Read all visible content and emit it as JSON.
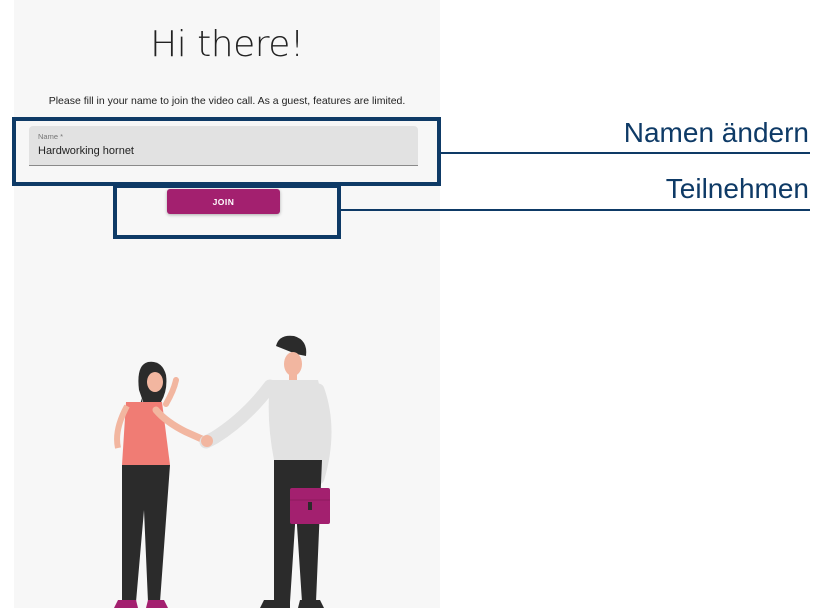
{
  "page": {
    "title": "Hi there!",
    "subtitle": "Please fill in your name to join the video call. As a guest, features are limited."
  },
  "name_field": {
    "label": "Name *",
    "value": "Hardworking hornet"
  },
  "join_button": {
    "label": "JOIN"
  },
  "annotations": {
    "change_name": "Namen ändern",
    "join": "Teilnehmen"
  },
  "colors": {
    "accent": "#a3206f",
    "annotation": "#0e3a66",
    "panel_background": "#f7f7f7"
  },
  "illustration": {
    "icon": "handshake-illustration"
  }
}
